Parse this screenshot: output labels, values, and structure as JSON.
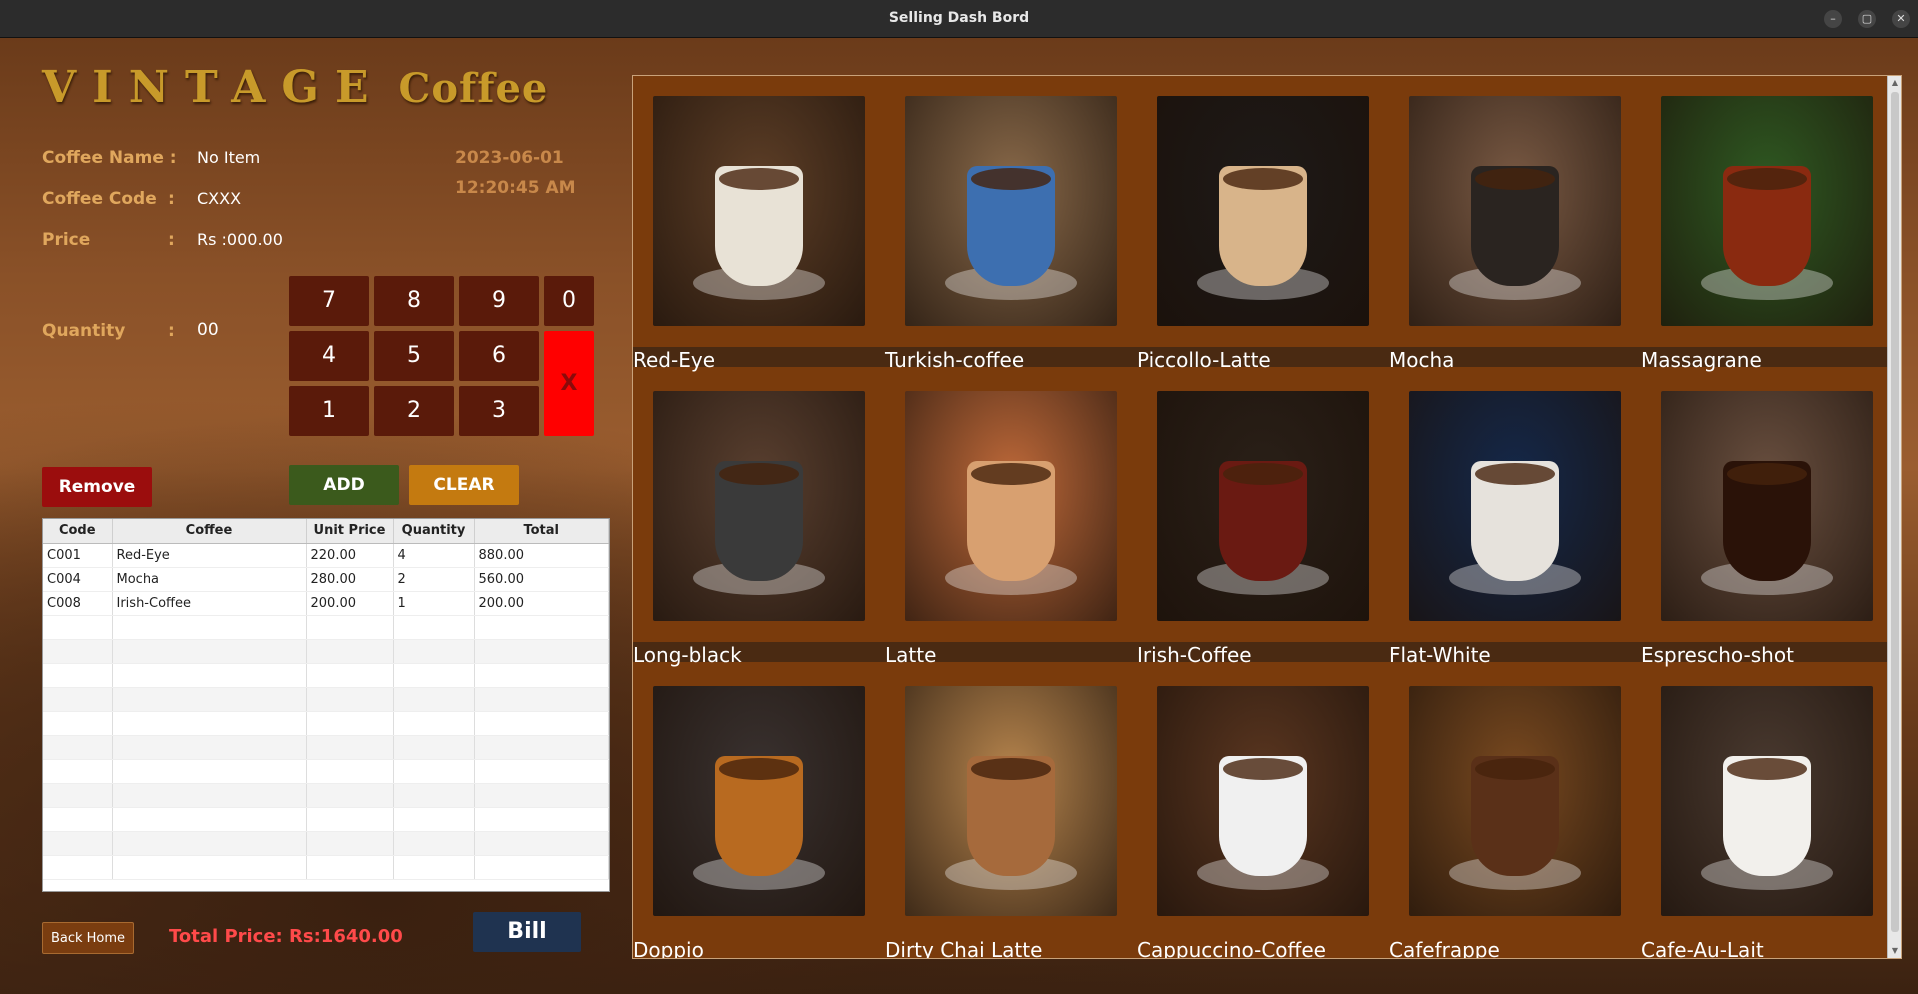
{
  "window": {
    "title": "Selling Dash Bord",
    "min": "–",
    "max": "▢",
    "close": "✕"
  },
  "brand": {
    "word1": "VINTAGE",
    "word2": "Coffee"
  },
  "details": {
    "name_label": "Coffee Name :",
    "name_value": "No Item",
    "code_label": "Coffee Code",
    "code_value": "CXXX",
    "price_label": "Price",
    "price_value": "Rs :000.00",
    "qty_label": "Quantity",
    "qty_value": "00",
    "colon": ":",
    "date": "2023-06-01",
    "time": "12:20:45 AM"
  },
  "keypad": {
    "k7": "7",
    "k8": "8",
    "k9": "9",
    "k0": "0",
    "k4": "4",
    "k5": "5",
    "k6": "6",
    "k1": "1",
    "k2": "2",
    "k3": "3",
    "clear_key": "X"
  },
  "buttons": {
    "remove": "Remove",
    "add": "ADD",
    "clear": "CLEAR",
    "back": "Back Home",
    "bill": "Bill"
  },
  "colors": {
    "remove": "#9b0d0d",
    "add": "#3b5a1c",
    "clear": "#c47a10",
    "bill": "#1f3350",
    "back": "#7a3d10",
    "total": "#ff4a4a"
  },
  "table": {
    "headers": [
      "Code",
      "Coffee",
      "Unit Price",
      "Quantity",
      "Total"
    ],
    "rows": [
      [
        "C001",
        "Red-Eye",
        "220.00",
        "4",
        "880.00"
      ],
      [
        "C004",
        "Mocha",
        "280.00",
        "2",
        "560.00"
      ],
      [
        "C008",
        "Irish-Coffee",
        "200.00",
        "1",
        "200.00"
      ]
    ]
  },
  "total": "Total Price: Rs:1640.00",
  "products": [
    {
      "name": "Red-Eye",
      "bg": "#5e3f27",
      "cup": "#e8e2d6"
    },
    {
      "name": "Turkish-coffee",
      "bg": "#8a6a4a",
      "cup": "#3d6fb0"
    },
    {
      "name": "Piccollo-Latte",
      "bg": "#1e1a18",
      "cup": "#d8b48a"
    },
    {
      "name": "Mocha",
      "bg": "#7a5a44",
      "cup": "#2a2420"
    },
    {
      "name": "Massagrane",
      "bg": "#2f5a22",
      "cup": "#8a2a10"
    },
    {
      "name": "Long-black",
      "bg": "#5a4030",
      "cup": "#3a3a3a"
    },
    {
      "name": "Latte",
      "bg": "#c06a3a",
      "cup": "#d8a070"
    },
    {
      "name": "Irish-Coffee",
      "bg": "#2a2018",
      "cup": "#6a1a12"
    },
    {
      "name": "Flat-White",
      "bg": "#14284a",
      "cup": "#e6e2dc"
    },
    {
      "name": "Esprescho-shot",
      "bg": "#6a5040",
      "cup": "#2a1208"
    },
    {
      "name": "Doppio",
      "bg": "#3a3230",
      "cup": "#b86a20"
    },
    {
      "name": "Dirty Chai Latte",
      "bg": "#b8864e",
      "cup": "#a66a3c"
    },
    {
      "name": "Cappuccino-Coffee",
      "bg": "#5a3620",
      "cup": "#f0f0f0"
    },
    {
      "name": "Cafefrappe",
      "bg": "#7a4a20",
      "cup": "#5a3018"
    },
    {
      "name": "Cafe-Au-Lait",
      "bg": "#4a3a30",
      "cup": "#f2f0ec"
    }
  ]
}
